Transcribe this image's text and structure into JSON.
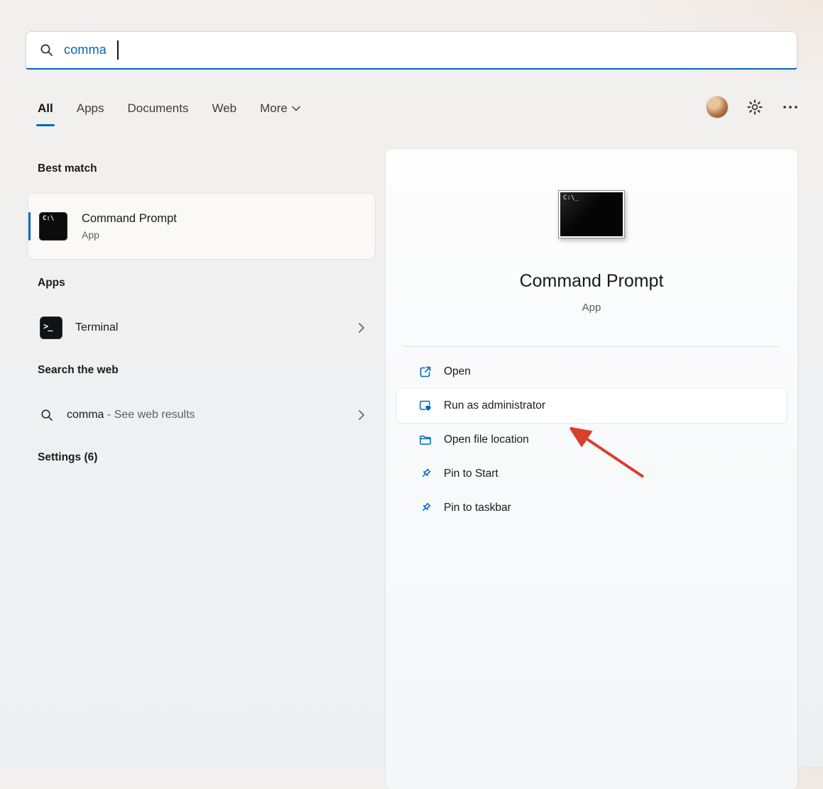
{
  "colors": {
    "accent": "#0067c0",
    "arrow": "#d93f2e"
  },
  "search": {
    "value": "comma"
  },
  "tabs": {
    "items": [
      {
        "label": "All"
      },
      {
        "label": "Apps"
      },
      {
        "label": "Documents"
      },
      {
        "label": "Web"
      },
      {
        "label": "More"
      }
    ]
  },
  "left": {
    "best_match_heading": "Best match",
    "best_match": {
      "title": "Command Prompt",
      "subtitle": "App",
      "icon_text": "C:\\"
    },
    "apps_heading": "Apps",
    "apps": [
      {
        "label": "Terminal",
        "icon_text": ">_"
      }
    ],
    "web_heading": "Search the web",
    "web": [
      {
        "query": "comma",
        "suffix": " - See web results",
        "icon": "search-icon"
      }
    ],
    "settings_heading": "Settings (6)"
  },
  "preview": {
    "icon_text": "C:\\_",
    "title": "Command Prompt",
    "subtitle": "App",
    "actions": [
      {
        "label": "Open",
        "icon": "open-external-icon"
      },
      {
        "label": "Run as administrator",
        "icon": "admin-shield-icon",
        "highlighted": true
      },
      {
        "label": "Open file location",
        "icon": "folder-icon"
      },
      {
        "label": "Pin to Start",
        "icon": "pin-icon"
      },
      {
        "label": "Pin to taskbar",
        "icon": "pin-icon"
      }
    ]
  },
  "annotation": {
    "type": "arrow",
    "target": "Run as administrator",
    "color": "#d93f2e"
  }
}
